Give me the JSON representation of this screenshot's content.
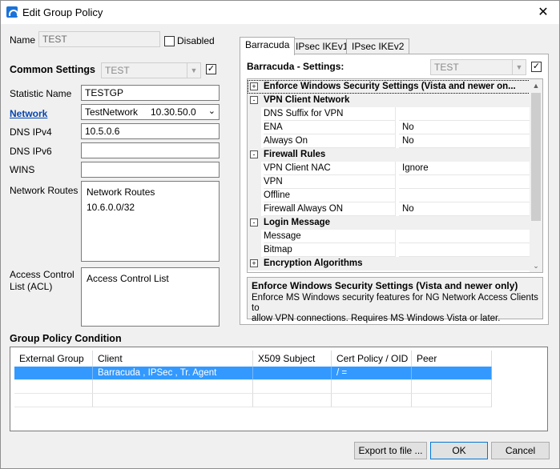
{
  "window": {
    "title": "Edit Group Policy",
    "close_label": "✕"
  },
  "left": {
    "name_label": "Name",
    "name_value": "TEST",
    "disabled_label": "Disabled",
    "common_settings_label": "Common Settings",
    "common_settings_value": "TEST",
    "statistic_name_label": "Statistic Name",
    "statistic_name_value": "TESTGP",
    "network_label": "Network",
    "network_value": "TestNetwork",
    "network_ip": "10.30.50.0",
    "dns_ipv4_label": "DNS IPv4",
    "dns_ipv4_value": "10.5.0.6",
    "dns_ipv6_label": "DNS IPv6",
    "dns_ipv6_value": "",
    "wins_label": "WINS",
    "wins_value": "",
    "network_routes_label": "Network Routes",
    "network_routes_items": [
      "Network Routes",
      "10.6.0.0/32"
    ],
    "acl_label_line1": "Access Control",
    "acl_label_line2": "List (ACL)",
    "acl_items": [
      "Access Control List"
    ]
  },
  "tabs": [
    {
      "label": "Barracuda",
      "active": true
    },
    {
      "label": "IPsec IKEv1",
      "active": false
    },
    {
      "label": "IPsec IKEv2",
      "active": false
    }
  ],
  "panel": {
    "settings_label": "Barracuda - Settings:",
    "settings_value": "TEST",
    "rows": [
      {
        "type": "cat",
        "expand": "+",
        "name": "Enforce Windows Security Settings (Vista and newer on..."
      },
      {
        "type": "cat",
        "expand": "-",
        "name": "VPN Client Network"
      },
      {
        "type": "prop",
        "name": "DNS Suffix for VPN",
        "value": ""
      },
      {
        "type": "prop",
        "name": "ENA",
        "value": "No"
      },
      {
        "type": "prop",
        "name": "Always On",
        "value": "No"
      },
      {
        "type": "cat",
        "expand": "-",
        "name": "Firewall Rules"
      },
      {
        "type": "prop",
        "name": "VPN Client NAC",
        "value": "Ignore"
      },
      {
        "type": "prop",
        "name": "VPN",
        "value": ""
      },
      {
        "type": "prop",
        "name": "Offline",
        "value": ""
      },
      {
        "type": "prop",
        "name": "Firewall Always ON",
        "value": "No"
      },
      {
        "type": "cat",
        "expand": "-",
        "name": "Login Message"
      },
      {
        "type": "prop",
        "name": "Message",
        "value": ""
      },
      {
        "type": "prop",
        "name": "Bitmap",
        "value": ""
      },
      {
        "type": "cat",
        "expand": "+",
        "name": "Encryption Algorithms"
      }
    ],
    "desc_title": "Enforce Windows Security Settings (Vista and newer only)",
    "desc_line1": "Enforce MS Windows security features for NG Network Access Clients to",
    "desc_line2": "allow VPN connections. Requires MS Windows Vista or later."
  },
  "condition": {
    "label": "Group Policy Condition",
    "columns": [
      "External Group",
      "Client",
      "X509 Subject",
      "Cert Policy / OID",
      "Peer"
    ],
    "rows": [
      [
        "",
        "Barracuda , IPSec , Tr. Agent",
        "",
        "/ =",
        ""
      ]
    ]
  },
  "buttons": {
    "export": "Export to file ...",
    "ok": "OK",
    "cancel": "Cancel"
  }
}
